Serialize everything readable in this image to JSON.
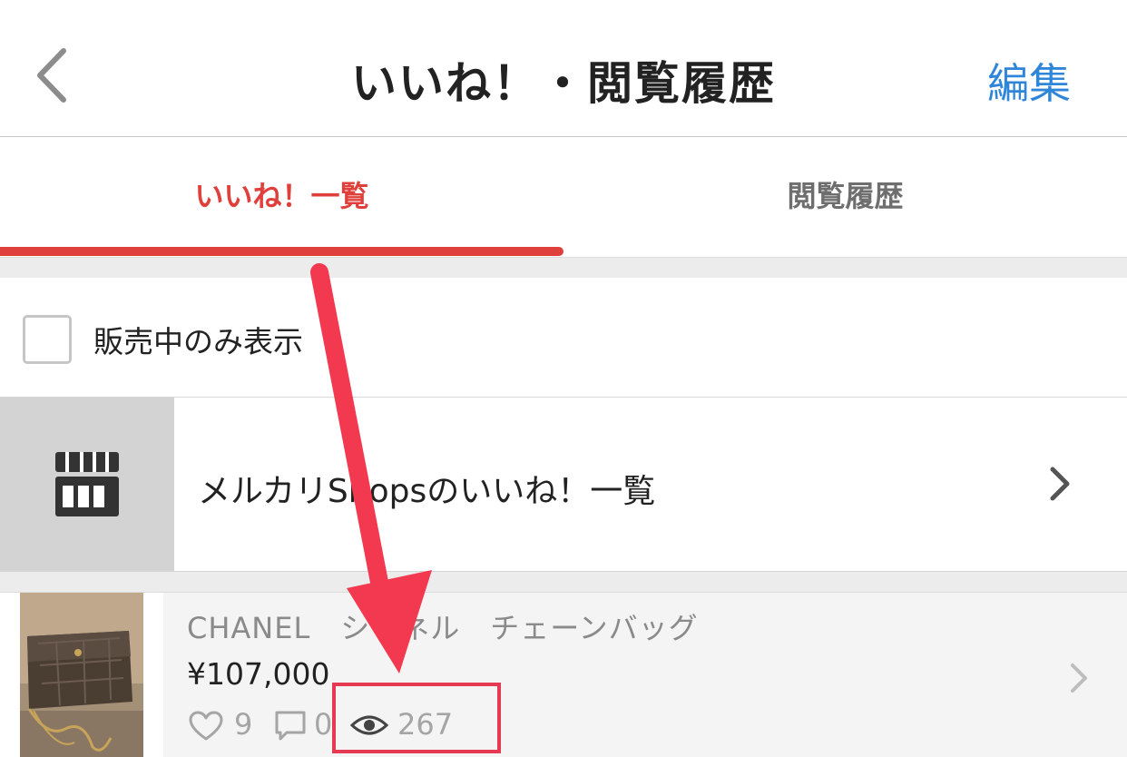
{
  "navbar": {
    "title": "いいね！・閲覧履歴",
    "edit_label": "編集"
  },
  "tabs": [
    {
      "label": "いいね！一覧",
      "active": true
    },
    {
      "label": "閲覧履歴",
      "active": false
    }
  ],
  "filter": {
    "label": "販売中のみ表示",
    "checked": false
  },
  "shops_link": {
    "label": "メルカリShopsのいいね！一覧"
  },
  "item": {
    "name": "CHANEL　シャネル　チェーンバッグ",
    "price": "¥107,000",
    "likes": "9",
    "comments": "0",
    "views": "267"
  },
  "colors": {
    "accent_red": "#e0403c",
    "link_blue": "#2f86d9",
    "annotation_red": "#e63a52"
  },
  "icons": [
    "back-chevron-icon",
    "store-icon",
    "chevron-right-icon",
    "heart-icon",
    "comment-icon",
    "eye-icon"
  ]
}
